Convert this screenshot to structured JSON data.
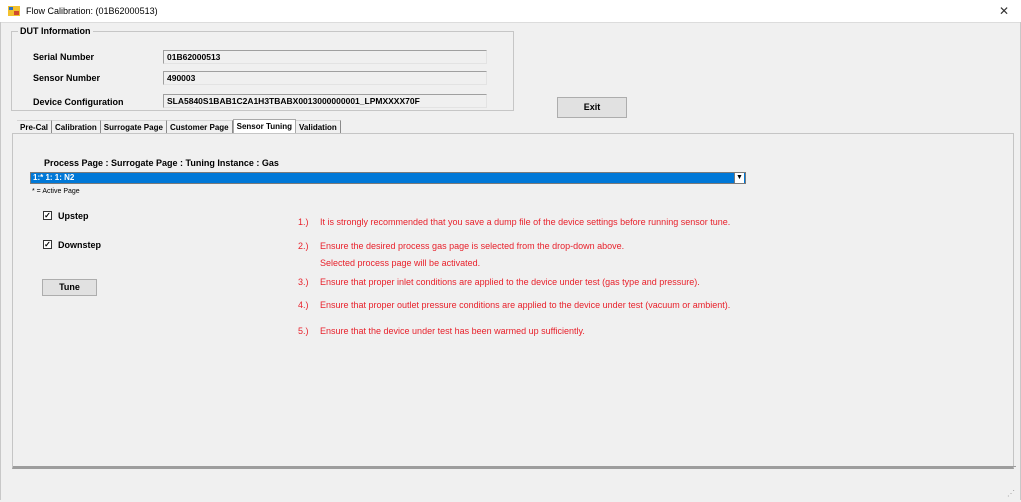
{
  "window": {
    "title": "Flow Calibration: (01B62000513)",
    "close_glyph": "✕",
    "app_icon": "flow-app-icon"
  },
  "dut": {
    "legend": "DUT Information",
    "serial_label": "Serial Number",
    "serial_value": "01B62000513",
    "sensor_label": "Sensor Number",
    "sensor_value": "490003",
    "config_label": "Device Configuration",
    "config_value": "SLA5840S1BAB1C2A1H3TBABX0013000000001_LPMXXXX70F"
  },
  "exit_label": "Exit",
  "tabs": [
    {
      "label": "Pre-Cal"
    },
    {
      "label": "Calibration"
    },
    {
      "label": "Surrogate Page"
    },
    {
      "label": "Customer Page"
    },
    {
      "label": "Sensor Tuning",
      "active": true
    },
    {
      "label": "Validation"
    }
  ],
  "tuning": {
    "process_label": "Process Page : Surrogate Page : Tuning Instance : Gas",
    "selected_value": "1:* 1: 1: N2",
    "active_note": "* = Active Page",
    "upstep_label": "Upstep",
    "upstep_checked": true,
    "downstep_label": "Downstep",
    "downstep_checked": true,
    "tune_label": "Tune",
    "check_glyph": "✓",
    "dropdown_glyph": "▼"
  },
  "instructions": [
    {
      "num": "1.)",
      "text": "It is strongly recommended that you save a dump file of the device settings before running sensor tune."
    },
    {
      "num": "2.)",
      "text": "Ensure the desired process gas page is selected from the drop-down above."
    },
    {
      "num": "",
      "text": "Selected process page will be activated."
    },
    {
      "num": "3.)",
      "text": "Ensure that proper inlet conditions are applied to the device under test (gas type and pressure)."
    },
    {
      "num": "4.)",
      "text": "Ensure that proper outlet pressure conditions are applied to the device under test (vacuum or ambient)."
    },
    {
      "num": "5.)",
      "text": "Ensure that the device under test has been warmed up sufficiently."
    }
  ],
  "colors": {
    "instruction_text": "#e8212b",
    "selection_bg": "#0078d7"
  }
}
